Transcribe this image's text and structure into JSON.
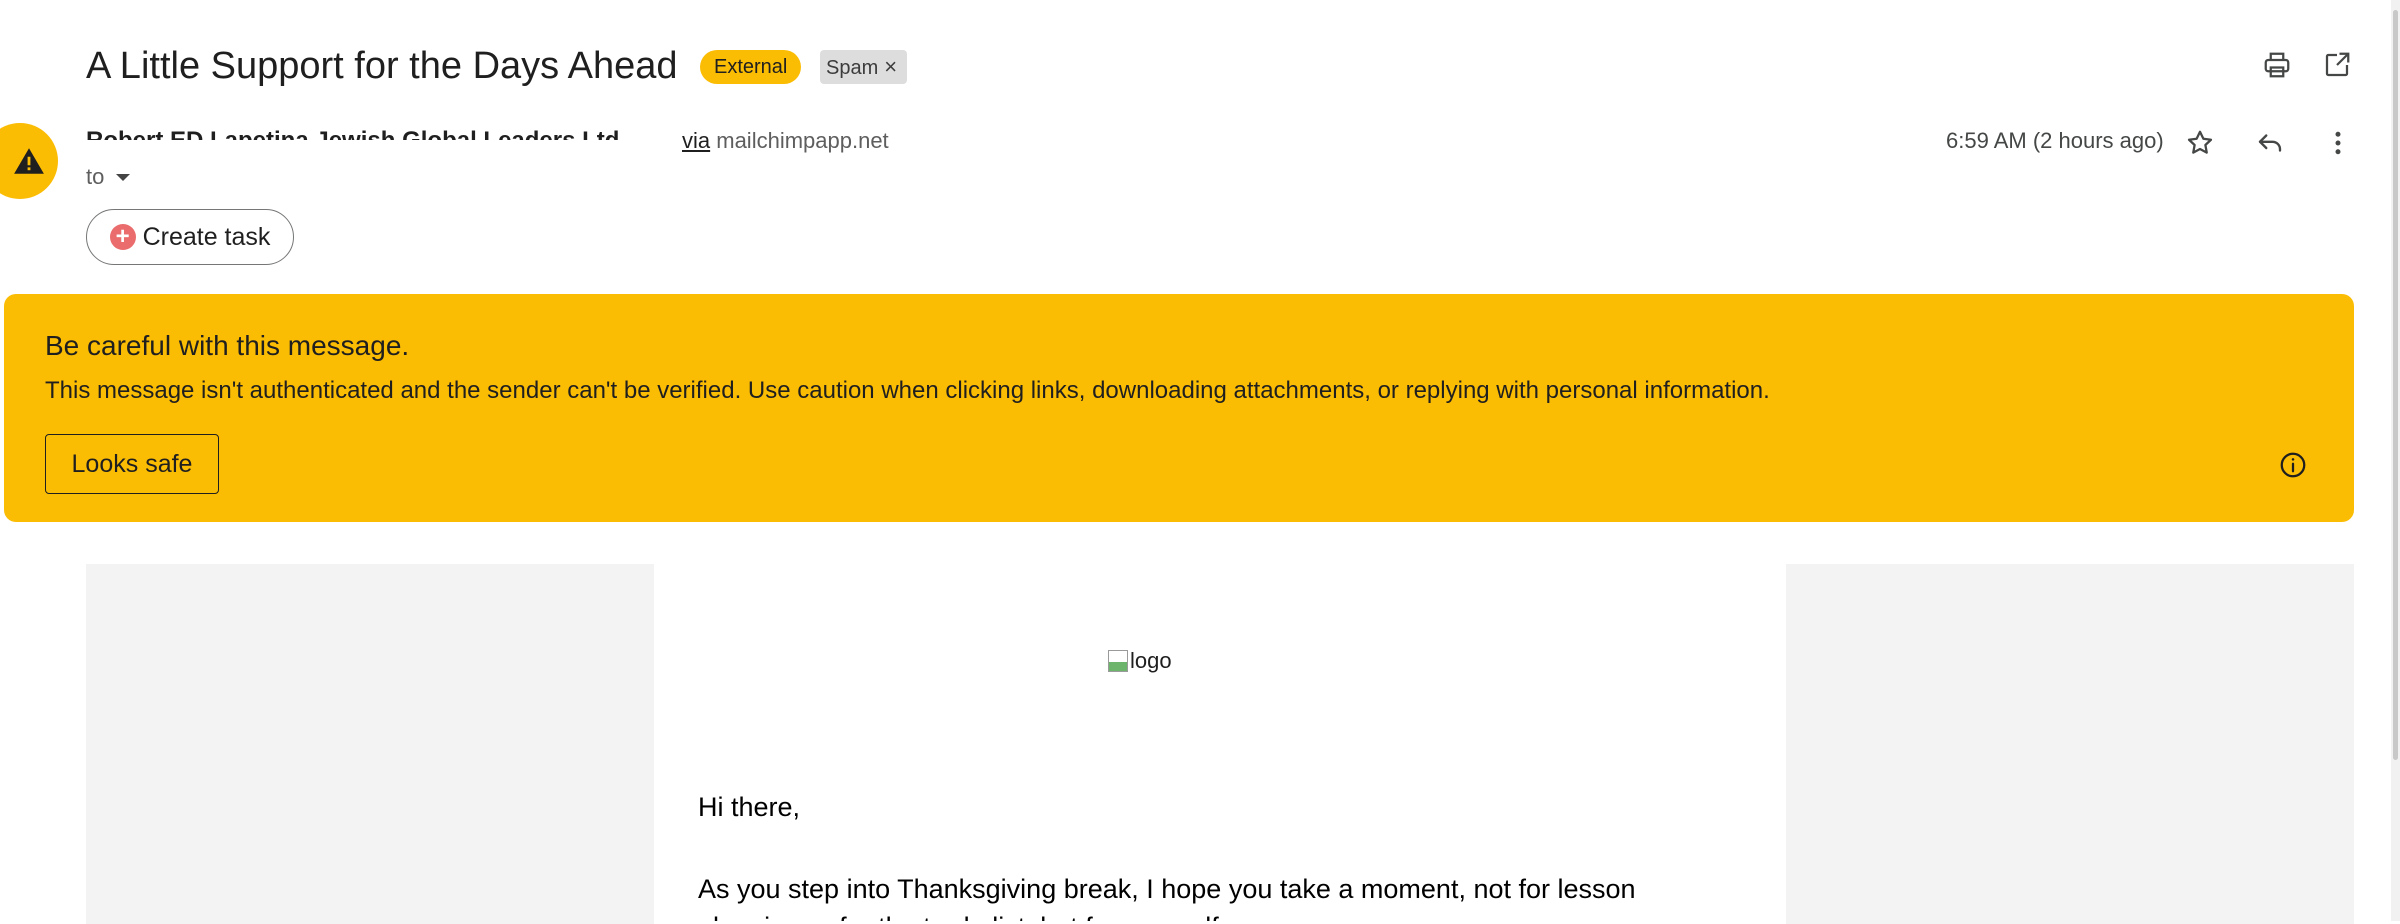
{
  "email": {
    "subject": "A Little Support for the Days Ahead",
    "labels": {
      "external": "External",
      "spam": "Spam",
      "spam_remove": "×"
    },
    "sender": {
      "name": "Robert ED Lapetina Jewish Global Leaders Ltd",
      "via_prefix": "via",
      "via_domain": "mailchimpapp.net"
    },
    "recipient_prefix": "to",
    "timestamp": "6:59 AM (2 hours ago)",
    "create_task_label": "Create task"
  },
  "warning": {
    "title": "Be careful with this message.",
    "text": "This message isn't authenticated and the sender can't be verified. Use caution when clicking links, downloading attachments, or replying with personal information.",
    "button": "Looks safe"
  },
  "body": {
    "logo_alt": "logo",
    "greeting": "Hi there,",
    "paragraph": "As you step into Thanksgiving break, I hope you take a moment, not for lesson",
    "paragraph_next": "planning or for the to-do list, but for yourself"
  },
  "icons": {
    "print": "print-icon",
    "open_new_window": "open-in-new-window-icon",
    "star": "star-icon",
    "reply": "reply-icon",
    "more": "more-vert-icon",
    "warning": "warning-icon",
    "info": "info-icon"
  },
  "colors": {
    "warning_banner": "#fbbc04",
    "external_label": "#fbbc04",
    "spam_label": "#dddddd",
    "create_task_plus": "#ea6c6c"
  }
}
